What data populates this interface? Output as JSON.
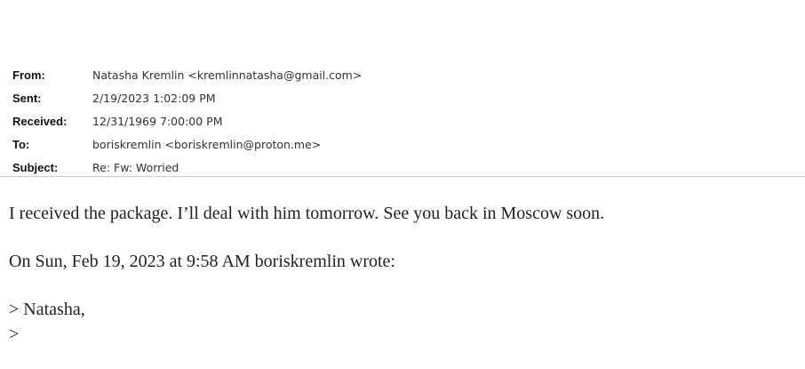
{
  "header": {
    "from_label": "From:",
    "from_value": "Natasha Kremlin <kremlinnatasha@gmail.com>",
    "sent_label": "Sent:",
    "sent_value": "2/19/2023 1:02:09 PM",
    "received_label": "Received:",
    "received_value": "12/31/1969 7:00:00 PM",
    "to_label": "To:",
    "to_value": "boriskremlin <boriskremlin@proton.me>",
    "subject_label": "Subject:",
    "subject_value": "Re: Fw: Worried"
  },
  "body": {
    "paragraph_1": "I received the package. I’ll deal with him tomorrow. See you back in Moscow soon.",
    "paragraph_2": "On Sun, Feb 19, 2023 at 9:58 AM boriskremlin wrote:",
    "quote_line_1": "> Natasha,",
    "quote_line_2": ">"
  }
}
